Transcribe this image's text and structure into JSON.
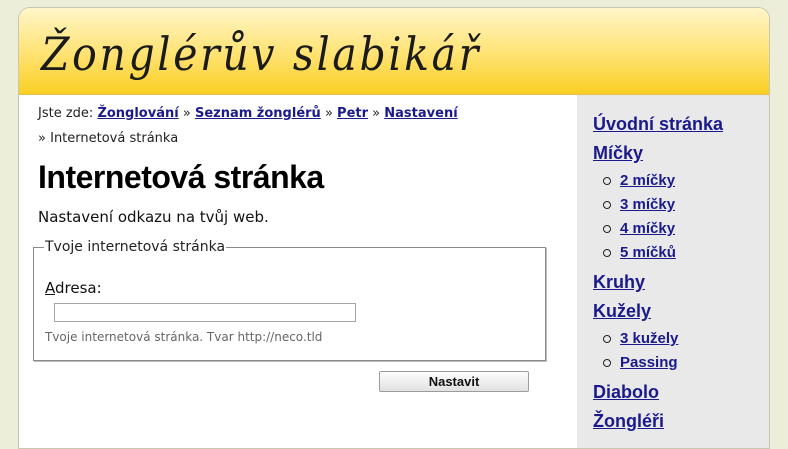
{
  "header": {
    "logo_text": "Žonglérův slabikář"
  },
  "breadcrumb": {
    "prefix": "Jste zde:",
    "links": [
      "Žonglování",
      "Seznam žonglérů",
      "Petr",
      "Nastavení"
    ],
    "separator": "»",
    "current": "Internetová stránka"
  },
  "main": {
    "title": "Internetová stránka",
    "description": "Nastavení odkazu na tvůj web.",
    "fieldset": {
      "legend": "Tvoje internetová stránka",
      "label_accesskey": "A",
      "label_rest": "dresa:",
      "input_value": "",
      "hint": "Tvoje internetová stránka. Tvar http://neco.tld"
    },
    "submit_label": "Nastavit"
  },
  "sidebar": {
    "items": [
      {
        "label": "Úvodní stránka",
        "children": []
      },
      {
        "label": "Míčky",
        "children": [
          "2 míčky",
          "3 míčky",
          "4 míčky",
          "5 míčků"
        ]
      },
      {
        "label": "Kruhy",
        "children": []
      },
      {
        "label": "Kužely",
        "children": [
          "3 kužely",
          "Passing"
        ]
      },
      {
        "label": "Diabolo",
        "children": []
      },
      {
        "label": "Žongléři",
        "children": []
      }
    ]
  },
  "colors": {
    "link": "#1a1a8c",
    "header_yellow": "#f9cf22",
    "sidebar_bg": "#e9e9e9",
    "page_bg": "#edeed9"
  }
}
